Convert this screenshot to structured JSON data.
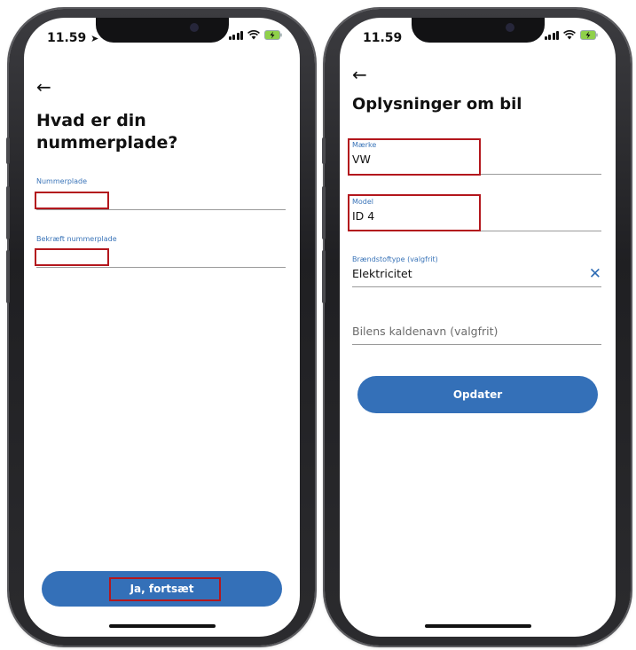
{
  "left_screen": {
    "status": {
      "time": "11.59"
    },
    "title": "Hvad er din nummerplade?",
    "title_line1": "Hvad er din",
    "title_line2": "nummerplade?",
    "fields": [
      {
        "label": "Nummerplade",
        "value": ""
      },
      {
        "label": "Bekræft nummerplade",
        "value": ""
      }
    ],
    "continue_label": "Ja, fortsæt"
  },
  "right_screen": {
    "status": {
      "time": "11.59"
    },
    "title": "Oplysninger om bil",
    "fields": [
      {
        "label": "Mærke",
        "value": "VW"
      },
      {
        "label": "Model",
        "value": "ID 4"
      },
      {
        "label": "Brændstoftype (valgfrit)",
        "value": "Elektricitet"
      },
      {
        "placeholder": "Bilens kaldenavn (valgfrit)"
      }
    ],
    "update_label": "Opdater"
  },
  "colors": {
    "accent": "#3470b8",
    "label_blue": "#3a74b8",
    "highlight_red": "#b3171d"
  },
  "icons": {
    "back": "arrow-left-icon",
    "clear": "close-icon",
    "location": "location-arrow-icon",
    "signal": "signal-icon",
    "wifi": "wifi-icon",
    "battery": "battery-charging-icon"
  }
}
